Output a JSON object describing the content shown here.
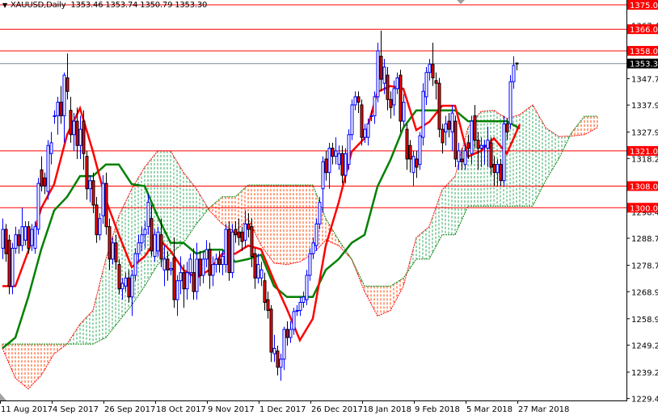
{
  "header": {
    "menu_icon": "triangle-down-icon",
    "symbol_timeframe": "XAUUSD,Daily",
    "ohlc": "1353.46 1353.74 1350.79 1353.30"
  },
  "chart_data": {
    "type": "candlestick",
    "title": "XAUUSD,Daily",
    "x_tick_labels": [
      "11 Aug 2017",
      "4 Sep 2017",
      "26 Sep 2017",
      "18 Oct 2017",
      "9 Nov 2017",
      "1 Dec 2017",
      "26 Dec 2017",
      "18 Jan 2018",
      "9 Feb 2018",
      "5 Mar 2018",
      "27 Mar 2018"
    ],
    "x_tick_bar_index": [
      0,
      16,
      32,
      48,
      64,
      80,
      96,
      112,
      128,
      144,
      160
    ],
    "y_tick_labels": [
      "1367.45",
      "1347.70",
      "1337.95",
      "1327.95",
      "1318.20",
      "1298.45",
      "1288.70",
      "1278.70",
      "1268.95",
      "1258.95",
      "1249.20",
      "1239.20",
      "1229.45"
    ],
    "ylim": [
      1229.45,
      1375.0
    ],
    "grid": false,
    "levels": [
      {
        "label": "1375.00",
        "value": 1375.0
      },
      {
        "label": "1366.00",
        "value": 1366.0
      },
      {
        "label": "1358.00",
        "value": 1358.0
      },
      {
        "label": "1321.00",
        "value": 1321.0
      },
      {
        "label": "1308.00",
        "value": 1308.0
      },
      {
        "label": "1300.00",
        "value": 1300.0
      }
    ],
    "current_price": {
      "label": "1353.30",
      "value": 1353.3
    },
    "colors": {
      "bull": "#0000ff",
      "bear_body": "#ff0000",
      "bear_outline": "#000000",
      "level_line": "#ff0000",
      "current_line": "#778899",
      "tenkan": "#ff0000",
      "kijun": "#008000",
      "cloud_bull": "#2eaa5c",
      "cloud_bear": "#ff4500"
    },
    "candles_ohlc": [
      [
        1285,
        1296,
        1281,
        1292
      ],
      [
        1292,
        1294,
        1280,
        1283
      ],
      [
        1288,
        1290,
        1268,
        1271
      ],
      [
        1271,
        1287,
        1268,
        1285
      ],
      [
        1285,
        1293,
        1283,
        1290
      ],
      [
        1290,
        1292,
        1283,
        1286
      ],
      [
        1286,
        1300,
        1284,
        1293
      ],
      [
        1288,
        1295,
        1286,
        1293
      ],
      [
        1293,
        1295,
        1283,
        1285
      ],
      [
        1286,
        1294,
        1284,
        1292
      ],
      [
        1285,
        1295,
        1283,
        1293
      ],
      [
        1292,
        1311,
        1290,
        1309
      ],
      [
        1314,
        1319,
        1306,
        1308
      ],
      [
        1311,
        1313,
        1305,
        1308
      ],
      [
        1306,
        1325,
        1303,
        1323
      ],
      [
        1320,
        1328,
        1316,
        1324
      ],
      [
        1334,
        1336,
        1331,
        1334
      ],
      [
        1334,
        1341,
        1327,
        1339
      ],
      [
        1339,
        1345,
        1331,
        1334
      ],
      [
        1334,
        1350,
        1324,
        1349
      ],
      [
        1348,
        1357,
        1340,
        1343
      ],
      [
        1336,
        1341,
        1324,
        1327
      ],
      [
        1327,
        1335,
        1321,
        1332
      ],
      [
        1332,
        1337,
        1318,
        1323
      ],
      [
        1323,
        1334,
        1318,
        1329
      ],
      [
        1332,
        1336,
        1314,
        1320
      ],
      [
        1319,
        1321,
        1303,
        1307
      ],
      [
        1307,
        1312,
        1302,
        1310
      ],
      [
        1310,
        1313,
        1298,
        1301
      ],
      [
        1301,
        1304,
        1287,
        1290
      ],
      [
        1290,
        1298,
        1288,
        1296
      ],
      [
        1297,
        1312,
        1294,
        1309
      ],
      [
        1309,
        1313,
        1290,
        1293
      ],
      [
        1293,
        1296,
        1277,
        1281
      ],
      [
        1281,
        1289,
        1279,
        1287
      ],
      [
        1287,
        1290,
        1277,
        1280
      ],
      [
        1279,
        1281,
        1268,
        1270
      ],
      [
        1270,
        1274,
        1266,
        1272
      ],
      [
        1271,
        1276,
        1269,
        1274
      ],
      [
        1274,
        1277,
        1265,
        1267
      ],
      [
        1267,
        1277,
        1260,
        1275
      ],
      [
        1275,
        1285,
        1273,
        1283
      ],
      [
        1283,
        1290,
        1280,
        1287
      ],
      [
        1287,
        1293,
        1284,
        1290
      ],
      [
        1290,
        1295,
        1285,
        1292
      ],
      [
        1293,
        1305,
        1290,
        1302
      ],
      [
        1296,
        1301,
        1282,
        1284
      ],
      [
        1282,
        1292,
        1280,
        1290
      ],
      [
        1284,
        1293,
        1282,
        1291
      ],
      [
        1290,
        1296,
        1278,
        1281
      ],
      [
        1277,
        1286,
        1271,
        1281
      ],
      [
        1281,
        1284,
        1273,
        1277
      ],
      [
        1277,
        1280,
        1275,
        1277.5
      ],
      [
        1281.5,
        1289,
        1263,
        1266
      ],
      [
        1266,
        1275,
        1260,
        1273
      ],
      [
        1273,
        1282,
        1268,
        1276
      ],
      [
        1276,
        1279,
        1263,
        1270
      ],
      [
        1270,
        1280,
        1266,
        1276
      ],
      [
        1276,
        1283,
        1272,
        1281
      ],
      [
        1276,
        1285,
        1266,
        1269
      ],
      [
        1269,
        1287,
        1266,
        1281
      ],
      [
        1281,
        1284,
        1271,
        1275
      ],
      [
        1275,
        1284,
        1272,
        1281
      ],
      [
        1281,
        1288,
        1278,
        1284.5
      ],
      [
        1284.5,
        1287,
        1270,
        1275
      ],
      [
        1275,
        1282,
        1271,
        1279
      ],
      [
        1279,
        1283,
        1276,
        1281
      ],
      [
        1281,
        1284,
        1276,
        1279
      ],
      [
        1279,
        1284,
        1275,
        1282
      ],
      [
        1279,
        1294,
        1276,
        1292
      ],
      [
        1292,
        1295,
        1273,
        1276
      ],
      [
        1276,
        1294,
        1274,
        1291
      ],
      [
        1292,
        1295,
        1287,
        1290
      ],
      [
        1291,
        1296,
        1286,
        1289
      ],
      [
        1291,
        1293,
        1284,
        1287.5
      ],
      [
        1288,
        1299,
        1285,
        1294
      ],
      [
        1294,
        1298,
        1289,
        1292
      ],
      [
        1293,
        1296,
        1278,
        1282
      ],
      [
        1283,
        1285,
        1270,
        1274
      ],
      [
        1274,
        1283,
        1272,
        1279
      ],
      [
        1274,
        1280,
        1271,
        1277
      ],
      [
        1273,
        1276,
        1262,
        1265
      ],
      [
        1266,
        1269,
        1259,
        1262
      ],
      [
        1262.5,
        1264,
        1243,
        1246.6
      ],
      [
        1246,
        1253,
        1243,
        1248
      ],
      [
        1247,
        1249,
        1238,
        1241
      ],
      [
        1241,
        1246,
        1236,
        1244
      ],
      [
        1244,
        1256,
        1240,
        1255
      ],
      [
        1255,
        1258,
        1249,
        1252
      ],
      [
        1252,
        1258,
        1250,
        1255
      ],
      [
        1255,
        1263,
        1253,
        1261.6
      ],
      [
        1262,
        1264,
        1260,
        1262
      ],
      [
        1262,
        1267,
        1260,
        1265
      ],
      [
        1265,
        1269,
        1263,
        1267
      ],
      [
        1266,
        1277,
        1264,
        1275
      ],
      [
        1275,
        1285,
        1273,
        1283
      ],
      [
        1283,
        1289,
        1281,
        1287
      ],
      [
        1286,
        1296,
        1284,
        1294
      ],
      [
        1294,
        1304,
        1292,
        1302
      ],
      [
        1307,
        1319,
        1298,
        1317
      ],
      [
        1318,
        1321,
        1310,
        1313
      ],
      [
        1313,
        1324,
        1307,
        1322
      ],
      [
        1322,
        1324,
        1316,
        1319
      ],
      [
        1319,
        1326,
        1316,
        1321
      ],
      [
        1316,
        1323,
        1314,
        1320
      ],
      [
        1320,
        1323,
        1309,
        1312
      ],
      [
        1312,
        1322,
        1309,
        1320
      ],
      [
        1316,
        1329,
        1314,
        1327
      ],
      [
        1327,
        1340,
        1325,
        1338
      ],
      [
        1338,
        1343,
        1336,
        1341
      ],
      [
        1341,
        1343,
        1335,
        1339
      ],
      [
        1338,
        1340,
        1323,
        1326
      ],
      [
        1326,
        1331,
        1324,
        1329
      ],
      [
        1326,
        1333,
        1323,
        1331
      ],
      [
        1334,
        1336,
        1332,
        1334
      ],
      [
        1334,
        1343,
        1331,
        1341
      ],
      [
        1341,
        1361,
        1339,
        1358
      ],
      [
        1356,
        1365.5,
        1343,
        1347.5
      ],
      [
        1346,
        1355,
        1342,
        1352
      ],
      [
        1349,
        1352,
        1336,
        1340
      ],
      [
        1340,
        1343,
        1333,
        1337
      ],
      [
        1338,
        1347,
        1334,
        1344
      ],
      [
        1344,
        1350,
        1342,
        1348
      ],
      [
        1349,
        1351,
        1328,
        1332
      ],
      [
        1332,
        1342,
        1330,
        1339
      ],
      [
        1329,
        1331,
        1314,
        1318
      ],
      [
        1323,
        1325,
        1313,
        1318
      ],
      [
        1313,
        1321,
        1308,
        1319
      ],
      [
        1318,
        1321,
        1311,
        1315
      ],
      [
        1316,
        1328,
        1314,
        1326.6
      ],
      [
        1326,
        1346,
        1323,
        1343
      ],
      [
        1341,
        1352,
        1338,
        1350
      ],
      [
        1350,
        1355,
        1347,
        1353
      ],
      [
        1353,
        1361,
        1345,
        1348
      ],
      [
        1347,
        1350,
        1340,
        1346
      ],
      [
        1346,
        1348,
        1326,
        1329
      ],
      [
        1329,
        1331,
        1320,
        1324
      ],
      [
        1328,
        1334,
        1323,
        1331
      ],
      [
        1332,
        1335,
        1326,
        1329
      ],
      [
        1328,
        1338,
        1321,
        1335
      ],
      [
        1332,
        1334,
        1315,
        1318
      ],
      [
        1317,
        1324,
        1314,
        1321
      ],
      [
        1318,
        1322,
        1314,
        1317
      ],
      [
        1316,
        1324,
        1314,
        1321
      ],
      [
        1324,
        1327,
        1318,
        1322
      ],
      [
        1320,
        1334,
        1316,
        1332
      ],
      [
        1334,
        1338,
        1322,
        1325
      ],
      [
        1325,
        1328,
        1314,
        1322
      ],
      [
        1322,
        1326,
        1315,
        1323
      ],
      [
        1323,
        1325,
        1316,
        1323
      ],
      [
        1322,
        1330,
        1315,
        1325
      ],
      [
        1324,
        1326,
        1312,
        1315
      ],
      [
        1316,
        1319,
        1308,
        1313
      ],
      [
        1313,
        1318,
        1308,
        1316
      ],
      [
        1316,
        1318,
        1308,
        1310
      ],
      [
        1310,
        1334,
        1308,
        1331
      ],
      [
        1331,
        1333,
        1325,
        1328
      ],
      [
        1331,
        1349,
        1329,
        1346.6
      ],
      [
        1346.6,
        1356,
        1344,
        1352.6
      ],
      [
        1353.46,
        1353.74,
        1350.79,
        1353.3
      ]
    ],
    "ichimoku": {
      "sample_every_bars": 4,
      "tenkan": [
        1271,
        1271,
        1284,
        1299.8,
        1308.7,
        1327,
        1336.8,
        1320.7,
        1302.8,
        1290,
        1278,
        1282,
        1289,
        1284,
        1277,
        1274,
        1277,
        1283,
        1283,
        1286,
        1284.6,
        1273,
        1262.5,
        1251,
        1259,
        1286,
        1302,
        1320.7,
        1325.7,
        1342.8,
        1345,
        1344,
        1328.7,
        1331.7,
        1337.7,
        1337.7,
        1318.9,
        1321,
        1325.7,
        1320,
        1330.8
      ],
      "kijun": [
        1248,
        1252,
        1267,
        1284.6,
        1299,
        1304,
        1311.7,
        1311.7,
        1316,
        1316,
        1308.7,
        1308,
        1296.8,
        1287,
        1287,
        1283,
        1284.5,
        1284.5,
        1280,
        1281,
        1282.6,
        1271,
        1267,
        1267,
        1267,
        1277,
        1281,
        1287,
        1290,
        1307.8,
        1317.7,
        1329.6,
        1336,
        1336,
        1336,
        1336,
        1332,
        1332,
        1332,
        1332,
        1329.3
      ],
      "span_a": [
        1248,
        1237,
        1233,
        1238,
        1246,
        1249.6,
        1257,
        1262,
        1281,
        1297,
        1307,
        1315,
        1321,
        1321,
        1313,
        1307,
        1299,
        1294,
        1291,
        1296,
        1286,
        1279.5,
        1279,
        1280,
        1283,
        1288,
        1286,
        1281,
        1269,
        1260,
        1262,
        1271,
        1289,
        1293,
        1306.6,
        1311.7,
        1329.6,
        1335.6,
        1336,
        1333,
        1334.4,
        1338,
        1329.6,
        1326.3,
        1326.5,
        1327,
        1329.6
      ],
      "span_b": [
        1249.6,
        1249.6,
        1249.6,
        1249.6,
        1249.6,
        1249.6,
        1249.6,
        1249.6,
        1252,
        1258,
        1264,
        1271,
        1279,
        1283,
        1287,
        1294,
        1300,
        1304,
        1304,
        1308.4,
        1308.4,
        1308.4,
        1308.4,
        1308.4,
        1308.4,
        1296,
        1288,
        1281,
        1271,
        1271,
        1271,
        1274,
        1281,
        1281,
        1290,
        1290,
        1300.6,
        1300.6,
        1300.6,
        1300.6,
        1300.6,
        1300.6,
        1310,
        1318,
        1327.7,
        1333.8,
        1333.8
      ]
    }
  }
}
